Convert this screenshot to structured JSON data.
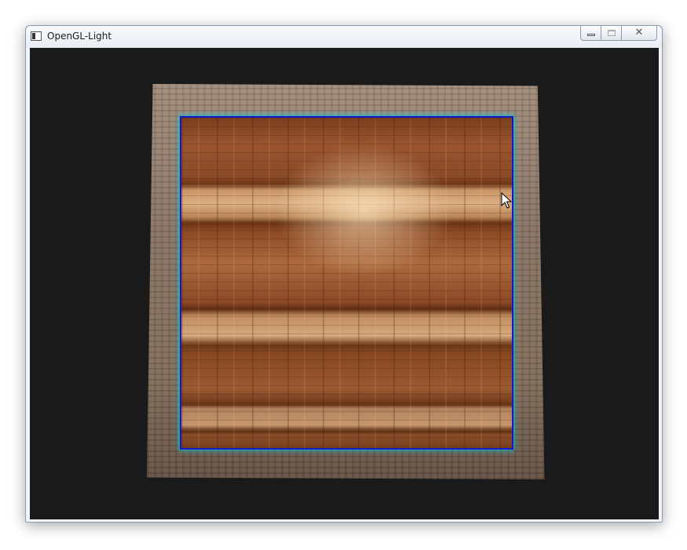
{
  "window": {
    "title": "OpenGL-Light"
  },
  "title_bar": {
    "app_icon": "console-window-icon",
    "controls": {
      "minimize_icon": "minimize-icon",
      "maximize_icon": "maximize-icon",
      "close_icon": "close-icon",
      "close_glyph": "✕"
    }
  },
  "viewport": {
    "background_color": "#1a1a1a",
    "scene": "wooden-crate-texture",
    "cursor_icon": "arrow-cursor-icon"
  },
  "colors": {
    "edge_highlight_blue": "#1418c8",
    "edge_highlight_cyan": "#19c6d6"
  }
}
